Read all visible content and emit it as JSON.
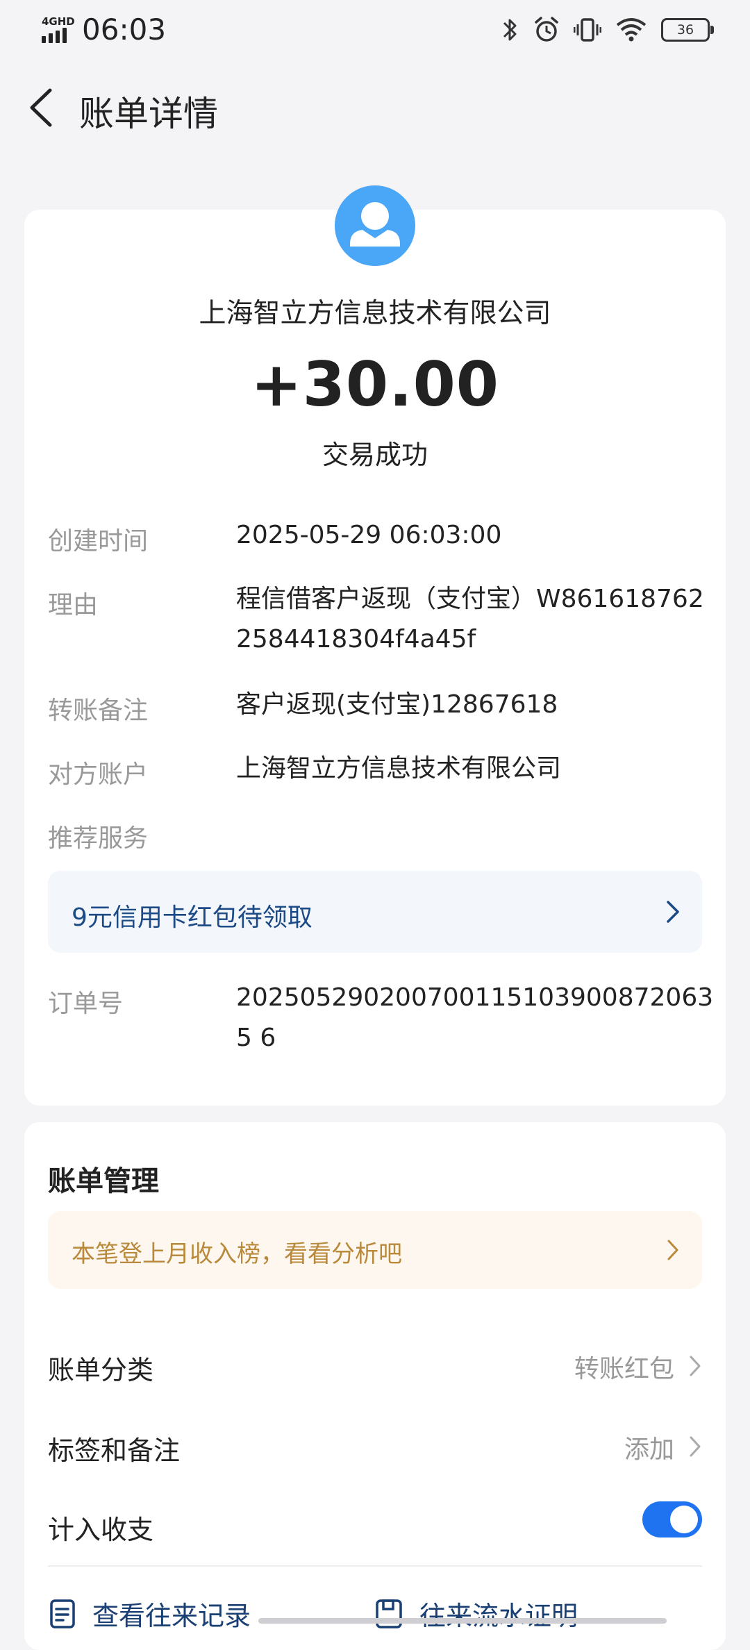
{
  "status_bar": {
    "network": "4GHD",
    "time": "06:03",
    "battery": "36"
  },
  "nav": {
    "title": "账单详情"
  },
  "transaction": {
    "counterparty": "上海智立方信息技术有限公司",
    "amount": "+30.00",
    "status": "交易成功"
  },
  "details": {
    "created_label": "创建时间",
    "created_value": "2025-05-29 06:03:00",
    "reason_label": "理由",
    "reason_value": "程信借客户返现（支付宝）W8616187622584418304f4a45f",
    "remark_label": "转账备注",
    "remark_value": "客户返现(支付宝)12867618",
    "account_label": "对方账户",
    "account_value": "上海智立方信息技术有限公司",
    "recommend_label": "推荐服务",
    "recommend_promo": "9元信用卡红包待领取",
    "order_label": "订单号",
    "order_value": "2025052902007001151039008720635 6"
  },
  "management": {
    "title": "账单管理",
    "promo": "本笔登上月收入榜，看看分析吧",
    "category_label": "账单分类",
    "category_value": "转账红包",
    "tags_label": "标签和备注",
    "tags_value": "添加",
    "include_label": "计入收支",
    "include_enabled": true,
    "link_records": "查看往来记录",
    "link_proof": "往来流水证明"
  },
  "colors": {
    "accent_blue": "#1f73f0",
    "avatar_blue": "#4aa6f6",
    "promo_text_blue": "#1b4a86",
    "promo_text_orange": "#b98a3c"
  },
  "icons": {
    "back": "chevron-left-icon",
    "avatar": "user-avatar-icon",
    "records": "document-list-icon",
    "proof": "save-document-icon"
  }
}
